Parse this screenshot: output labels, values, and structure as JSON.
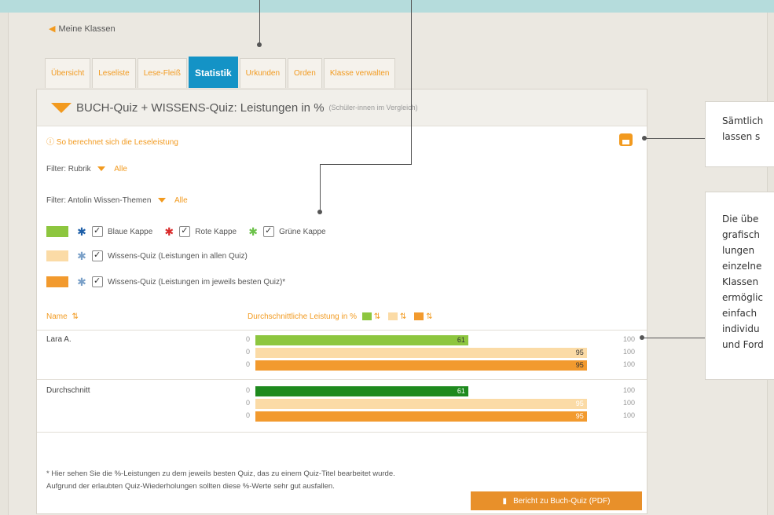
{
  "breadcrumb": "Meine Klassen",
  "tabs": [
    {
      "label": "Übersicht",
      "active": false
    },
    {
      "label": "Leseliste",
      "active": false
    },
    {
      "label": "Lese-Fleiß",
      "active": false
    },
    {
      "label": "Statistik",
      "active": true
    },
    {
      "label": "Urkunden",
      "active": false
    },
    {
      "label": "Orden",
      "active": false
    },
    {
      "label": "Klasse verwalten",
      "active": false
    }
  ],
  "panel": {
    "title": "BUCH-Quiz + WISSENS-Quiz: Leistungen in %",
    "subtitle": "(Schüler-innen im Vergleich)",
    "info": "So berechnet sich die Leseleistung",
    "filter1_label": "Filter: Rubrik",
    "filter1_value": "Alle",
    "filter2_label": "Filter: Antolin Wissen-Themen",
    "filter2_value": "Alle"
  },
  "legend": [
    {
      "label": "Blaue Kappe",
      "splat": "blue"
    },
    {
      "label": "Rote Kappe",
      "splat": "red"
    },
    {
      "label": "Grüne Kappe",
      "splat": "green"
    },
    {
      "label": "Wissens-Quiz (Leistungen in allen Quiz)"
    },
    {
      "label": "Wissens-Quiz (Leistungen im jeweils besten Quiz)*"
    }
  ],
  "table": {
    "col_name": "Name",
    "col_avg": "Durchschnittliche Leistung in %",
    "rows": [
      {
        "name": "Lara A.",
        "bars": [
          {
            "zero": "0",
            "value": 61,
            "label": "61",
            "max": "100",
            "color": "#8dc63f"
          },
          {
            "zero": "0",
            "value": 95,
            "label": "95",
            "max": "100",
            "color": "#fbdba6"
          },
          {
            "zero": "0",
            "value": 95,
            "label": "95",
            "max": "100",
            "color": "#f29a2e"
          }
        ]
      },
      {
        "name": "Durchschnitt",
        "bars": [
          {
            "zero": "0",
            "value": 61,
            "label": "61",
            "max": "100",
            "color": "#1e8a1e"
          },
          {
            "zero": "0",
            "value": 95,
            "label": "95",
            "max": "100",
            "color": "#fbdba6"
          },
          {
            "zero": "0",
            "value": 95,
            "label": "95",
            "max": "100",
            "color": "#f29a2e"
          }
        ]
      }
    ]
  },
  "footnote_line1": "* Hier sehen Sie die %-Leistungen zu dem jeweils besten Quiz, das zu einem Quiz-Titel bearbeitet wurde.",
  "footnote_line2": "Aufgrund der erlaubten Quiz-Wiederholungen sollten diese %-Werte sehr gut ausfallen.",
  "pdf_button": "Bericht zu Buch-Quiz (PDF)",
  "callout1": [
    "Sämtlich",
    "lassen s"
  ],
  "callout2": [
    "Die übe",
    "grafisch",
    "lungen",
    "einzelne",
    "Klassen",
    "ermöglic",
    "einfach",
    "individu",
    "und Ford"
  ],
  "colors": {
    "accent": "#f29a1f",
    "active_tab": "#1493c6",
    "green": "#8dc63f",
    "dark_green": "#1e8a1e",
    "light_orange": "#fbdba6",
    "orange": "#f29a2e"
  }
}
